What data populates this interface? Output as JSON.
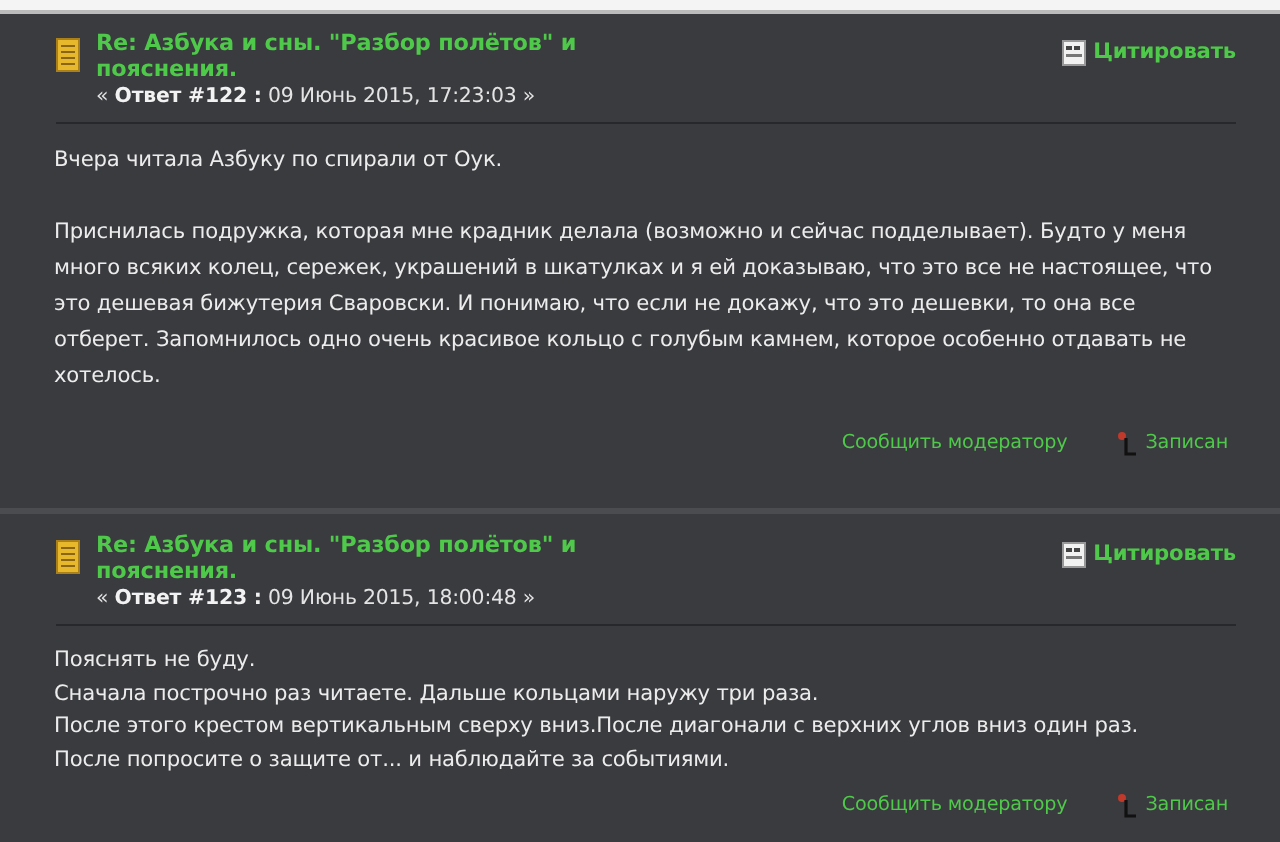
{
  "posts": [
    {
      "subject": "Re: Азбука и сны. \"Разбор полётов\" и пояснения.",
      "meta": "« **Ответ #122 :** 09 Июнь 2015, 17:23:03 »",
      "quote": "Цитировать",
      "paragraphs": [
        [
          "Вчера читала Азбуку по спирали от Оук."
        ],
        [
          "Приснилась подружка, которая мне крадник делала (возможно и сейчас подделывает). Будто у меня много всяких колец, сережек, украшений в шкатулках и я ей доказываю, что это все не настоящее, что это дешевая бижутерия Сваровски. И понимаю, что если не докажу, что это дешевки, то она все отберет. Запомнилось одно очень красивое кольцо с голубым камнем, которое особенно отдавать не хотелось."
        ]
      ],
      "report": "Сообщить модератору",
      "status": "Записан"
    },
    {
      "subject": "Re: Азбука и сны. \"Разбор полётов\" и пояснения.",
      "meta": "« **Ответ #123 :** 09 Июнь 2015, 18:00:48 »",
      "quote": "Цитировать",
      "paragraphs": [
        [
          "Пояснять не буду.",
          "Сначала построчно раз читаете. Дальше кольцами наружу три раза.",
          "После этого крестом вертикальным сверху вниз.После диагонали с верхних углов вниз один раз.",
          "После попросите о защите от... и наблюдайте за событиями."
        ]
      ],
      "report": "Сообщить модератору",
      "status": "Записан"
    }
  ]
}
